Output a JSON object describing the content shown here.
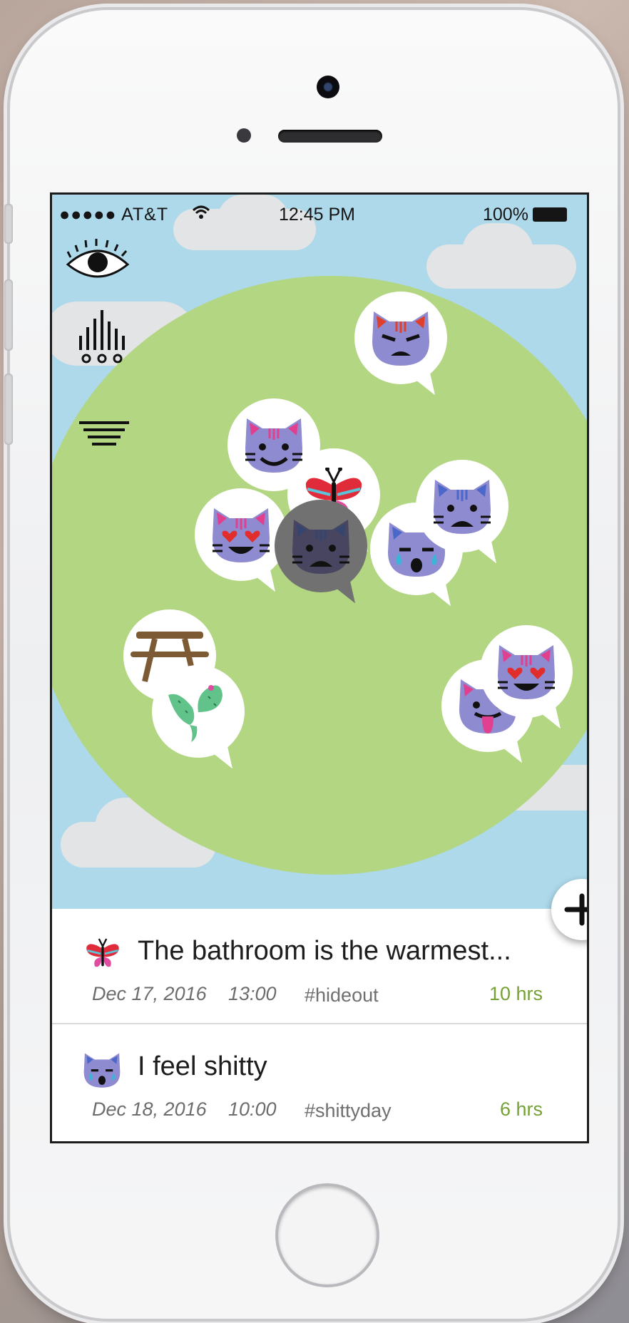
{
  "status_bar": {
    "carrier": "●●●●● AT&T",
    "wifi_icon": "wifi-icon",
    "time": "12:45 PM",
    "battery": "100%",
    "battery_icon": "battery-icon"
  },
  "sidebar_icons": [
    "eye-icon",
    "sound-wave-icon",
    "menu-lines-icon"
  ],
  "map_bubbles": [
    {
      "icon": "angry-cat-icon"
    },
    {
      "icon": "smiling-cat-icon"
    },
    {
      "icon": "butterfly-icon"
    },
    {
      "icon": "heart-eyes-cat-icon"
    },
    {
      "icon": "sad-cat-icon",
      "selected": true
    },
    {
      "icon": "crying-cat-icon"
    },
    {
      "icon": "frowning-cat-icon"
    },
    {
      "icon": "picnic-table-icon"
    },
    {
      "icon": "cactus-icon"
    },
    {
      "icon": "heart-eyes-cat-icon"
    },
    {
      "icon": "tongue-cat-icon"
    }
  ],
  "add_button_icon": "plus-icon",
  "posts": [
    {
      "icon": "butterfly-icon",
      "title": "The bathroom is the warmest...",
      "date": "Dec 17, 2016",
      "time": "13:00",
      "tag": "#hideout",
      "ago": "10 hrs"
    },
    {
      "icon": "crying-cat-icon",
      "title": "I feel shitty",
      "date": "Dec 18, 2016",
      "time": "10:00",
      "tag": "#shittyday",
      "ago": "6 hrs"
    }
  ],
  "colors": {
    "sky": "#add9ea",
    "planet": "#b2d682",
    "cat": "#8f8bd0",
    "accent_green": "#75a136"
  }
}
